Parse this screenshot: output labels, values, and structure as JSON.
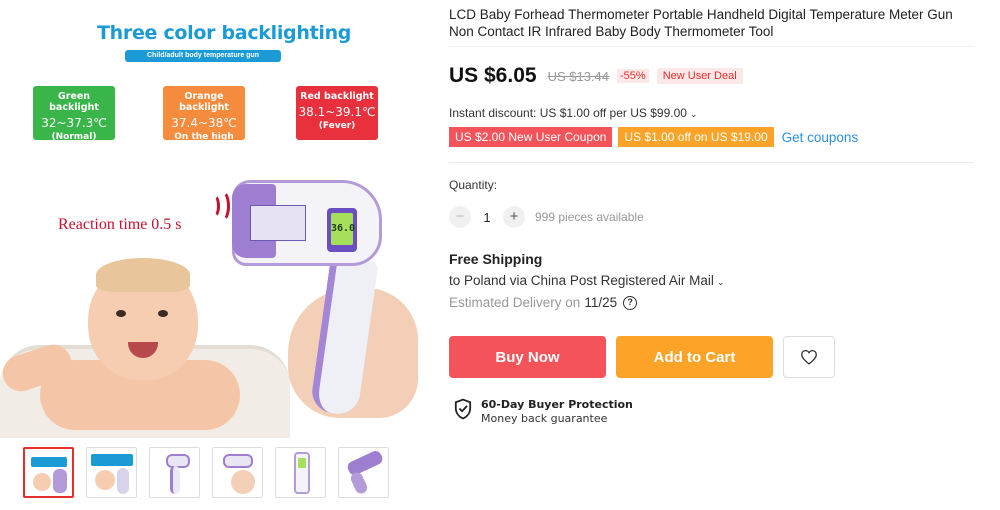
{
  "gallery": {
    "hero": {
      "title": "Three color backlighting",
      "subtitle": "Child/adult body temperature gun",
      "reaction_text": "Reaction time 0.5 s",
      "lcd_reading": "36.0",
      "backlights": [
        {
          "title": "Green backlight",
          "range": "32~37.3℃",
          "note": "(Normal)",
          "color": "#3ab54a"
        },
        {
          "title": "Orange backlight",
          "range": "37.4~38℃",
          "note": "On the high side",
          "color": "#f58b3c"
        },
        {
          "title": "Red backlight",
          "range": "38.1~39.1℃",
          "note": "(Fever)",
          "color": "#e8313d"
        }
      ]
    },
    "thumbnails_count": 6,
    "active_thumbnail": 1
  },
  "product": {
    "title": "LCD Baby Forhead Thermometer Portable Handheld Digital Temperature Meter Gun Non Contact IR Infrared Baby Body Thermometer Tool"
  },
  "price": {
    "current": "US $6.05",
    "original": "US $13.44",
    "discount": "-55%",
    "badge": "New User Deal"
  },
  "discounts": {
    "instant": "Instant discount: US $1.00 off per US $99.00",
    "coupons": [
      "US $2.00 New User Coupon",
      "US $1.00 off on US $19.00"
    ],
    "get_coupons": "Get coupons"
  },
  "quantity": {
    "label": "Quantity:",
    "minus": "−",
    "plus": "+",
    "value": "1",
    "available": "999 pieces available"
  },
  "shipping": {
    "title": "Free Shipping",
    "via": "to Poland via China Post Registered Air Mail",
    "estimated_label": "Estimated Delivery on",
    "estimated_date": "11/25"
  },
  "actions": {
    "buy_now": "Buy Now",
    "add_to_cart": "Add to Cart"
  },
  "protection": {
    "title": "60-Day Buyer Protection",
    "subtitle": "Money back guarantee"
  },
  "colors": {
    "buy_now": "#f5535a",
    "add_to_cart": "#fca328",
    "link": "#2d8ee6",
    "accent_red": "#e62e2e"
  }
}
